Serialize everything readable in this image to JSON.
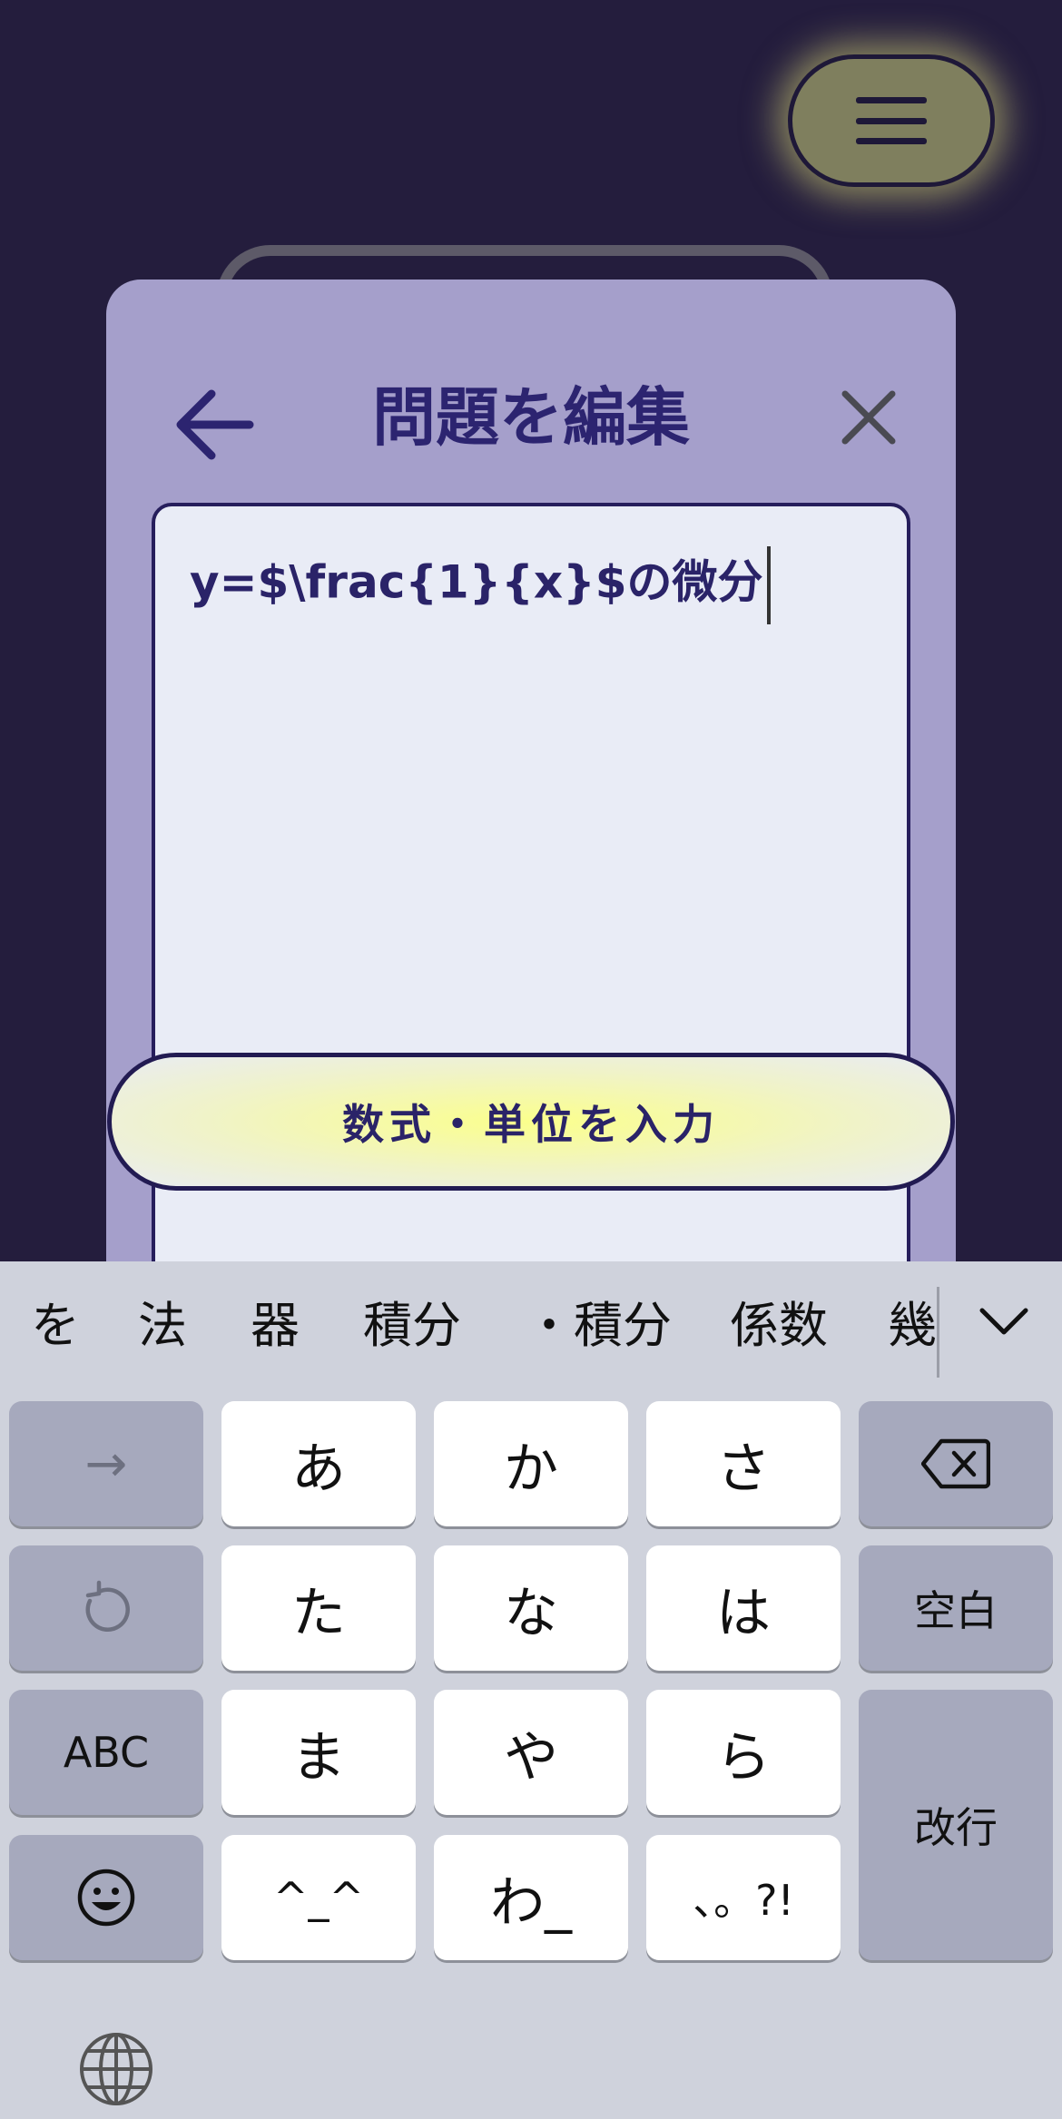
{
  "header": {
    "menu_icon": "hamburger-icon"
  },
  "dialog": {
    "title": "問題を編集",
    "back_icon": "arrow-left-icon",
    "close_icon": "close-icon",
    "editor_value": "y=$\\frac{1}{x}$の微分",
    "input_button_label": "数式・単位を入力"
  },
  "keyboard": {
    "candidates": [
      "を",
      "法",
      "器",
      "積分",
      "・積分",
      "係数",
      "幾"
    ],
    "expand_icon": "chevron-down-icon",
    "keys": {
      "row1": [
        "→",
        "あ",
        "か",
        "さ",
        "backspace"
      ],
      "row2": [
        "undo",
        "た",
        "な",
        "は",
        "空白"
      ],
      "row3": [
        "ABC",
        "ま",
        "や",
        "ら",
        "改行"
      ],
      "row4": [
        "emoji",
        "^_^",
        "わ_",
        "、。?!"
      ]
    },
    "labels": {
      "next": "→",
      "a": "あ",
      "ka": "か",
      "sa": "さ",
      "ta": "た",
      "na": "な",
      "ha": "は",
      "space": "空白",
      "abc": "ABC",
      "ma": "ま",
      "ya": "や",
      "ra": "ら",
      "return": "改行",
      "kaomoji": "^_^",
      "wa": "わ_",
      "punct": "、。?!"
    },
    "globe_icon": "globe-icon"
  }
}
